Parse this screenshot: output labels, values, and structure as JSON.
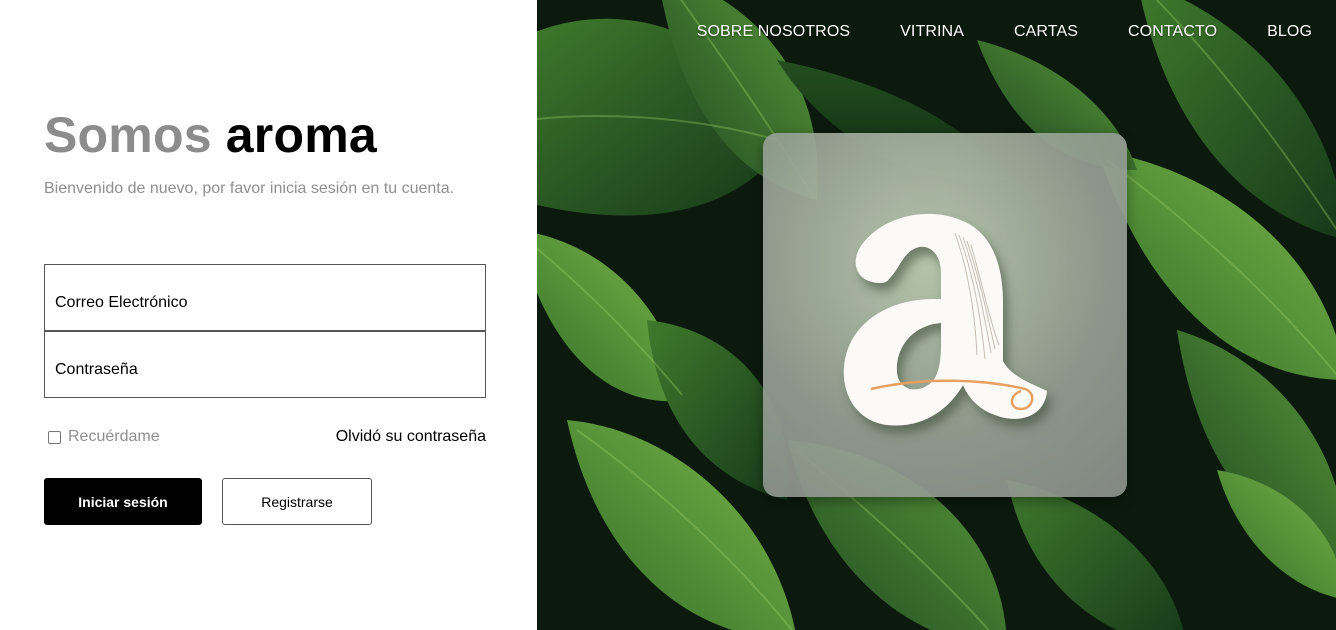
{
  "brand": {
    "title_part1": "Somos",
    "title_part2": "aroma",
    "subtitle": "Bienvenido de nuevo, por favor inicia sesión en tu cuenta."
  },
  "form": {
    "email_placeholder": "Correo Electrónico",
    "password_placeholder": "Contraseña",
    "remember_label": "Recuérdame",
    "remember_checked": false,
    "forgot_link": "Olvidó su contraseña",
    "login_button": "Iniciar sesión",
    "register_button": "Registrarse"
  },
  "nav": {
    "items": [
      "SOBRE NOSOTROS",
      "VITRINA",
      "CARTAS",
      "CONTACTO",
      "BLOG"
    ]
  },
  "colors": {
    "title_gray": "#8c8c8c",
    "subtitle_gray": "#8f8f8f",
    "button_dark": "#000000",
    "logo_accent": "#e8a060"
  }
}
